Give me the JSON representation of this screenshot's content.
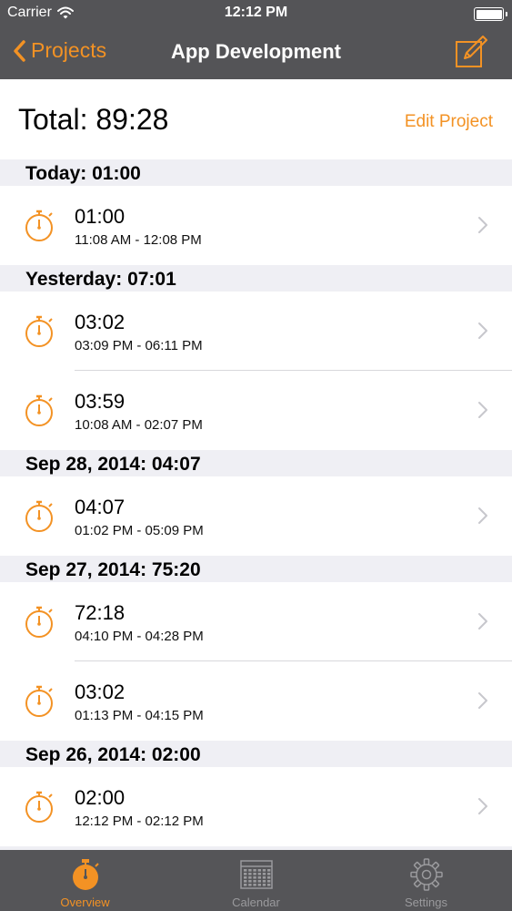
{
  "status_bar": {
    "carrier": "Carrier",
    "time": "12:12 PM"
  },
  "nav": {
    "back_label": "Projects",
    "title": "App Development"
  },
  "summary": {
    "total": "Total: 89:28",
    "edit_label": "Edit Project"
  },
  "sections": [
    {
      "header": "Today: 01:00",
      "entries": [
        {
          "duration": "01:00",
          "range": "11:08 AM - 12:08 PM"
        }
      ]
    },
    {
      "header": "Yesterday: 07:01",
      "entries": [
        {
          "duration": "03:02",
          "range": "03:09 PM - 06:11 PM"
        },
        {
          "duration": "03:59",
          "range": "10:08 AM - 02:07 PM"
        }
      ]
    },
    {
      "header": "Sep 28, 2014: 04:07",
      "entries": [
        {
          "duration": "04:07",
          "range": "01:02 PM - 05:09 PM"
        }
      ]
    },
    {
      "header": "Sep 27, 2014: 75:20",
      "entries": [
        {
          "duration": "72:18",
          "range": "04:10 PM - 04:28 PM"
        },
        {
          "duration": "03:02",
          "range": "01:13 PM - 04:15 PM"
        }
      ]
    },
    {
      "header": "Sep 26, 2014: 02:00",
      "entries": [
        {
          "duration": "02:00",
          "range": "12:12 PM - 02:12 PM"
        }
      ]
    }
  ],
  "tabs": [
    {
      "label": "Overview",
      "icon": "stopwatch-icon",
      "active": true
    },
    {
      "label": "Calendar",
      "icon": "calendar-icon",
      "active": false
    },
    {
      "label": "Settings",
      "icon": "gear-icon",
      "active": false
    }
  ],
  "colors": {
    "accent": "#f39224",
    "bar": "#545457",
    "tab_inactive": "#9a9a9d"
  }
}
